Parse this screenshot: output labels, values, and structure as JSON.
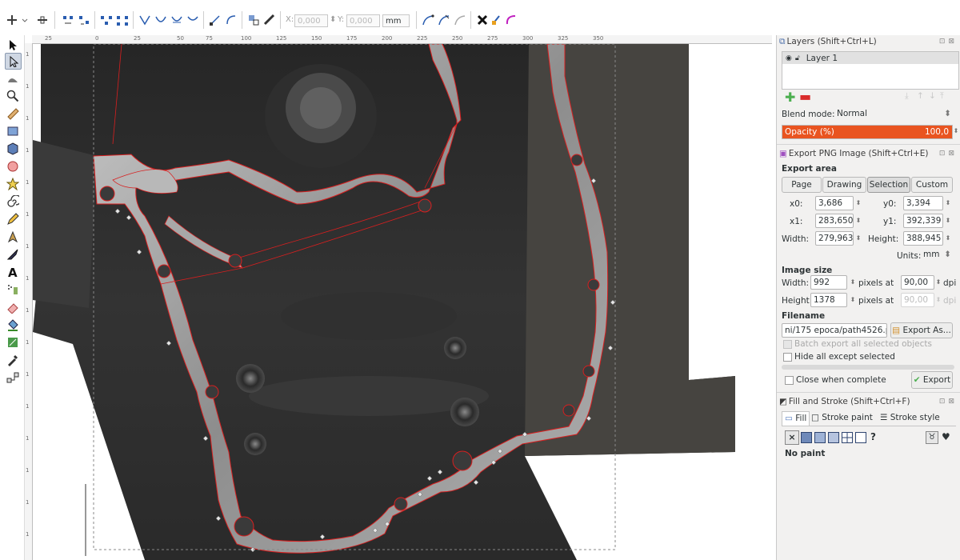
{
  "toolbar": {
    "x_label": "X:",
    "x_value": "0,000",
    "y_label": "Y:",
    "y_value": "0,000",
    "unit": "mm"
  },
  "rulers": {
    "top": [
      "25",
      "0",
      "25",
      "50",
      "75",
      "100",
      "125",
      "150",
      "175",
      "200",
      "225",
      "250",
      "275",
      "300",
      "325",
      "350"
    ],
    "left": [
      "1",
      "1",
      "1",
      "1",
      "1",
      "1",
      "1",
      "1",
      "1",
      "1",
      "1",
      "1",
      "1",
      "1",
      "1",
      "1"
    ]
  },
  "layers": {
    "title": "Layers (Shift+Ctrl+L)",
    "layer_name": "Layer 1",
    "blend_label": "Blend mode:",
    "blend_value": "Normal",
    "opacity_label": "Opacity (%)",
    "opacity_value": "100,0",
    "opacity_fraction": 1.0
  },
  "export": {
    "title": "Export PNG Image (Shift+Ctrl+E)",
    "area_label": "Export area",
    "tabs": [
      "Page",
      "Drawing",
      "Selection",
      "Custom"
    ],
    "active_tab": "Selection",
    "x0_label": "x0:",
    "x0": "3,686",
    "y0_label": "y0:",
    "y0": "3,394",
    "x1_label": "x1:",
    "x1": "283,650",
    "y1_label": "y1:",
    "y1": "392,339",
    "width_label": "Width:",
    "width": "279,963",
    "height_label": "Height:",
    "height": "388,945",
    "units_label": "Units:",
    "units": "mm",
    "image_size_label": "Image size",
    "img_width_label": "Width:",
    "img_width": "992",
    "img_height_label": "Height:",
    "img_height": "1378",
    "pixels_at": "pixels at",
    "dpi_value": "90,00",
    "dpi_value_disabled": "90,00",
    "dpi_label": "dpi",
    "filename_label": "Filename",
    "filename": "ni/175 epoca/path4526.png",
    "export_as": "Export As...",
    "batch_export": "Batch export all selected objects",
    "hide_all": "Hide all except selected",
    "close_when_complete": "Close when complete",
    "export_button": "Export"
  },
  "fill_stroke": {
    "title": "Fill and Stroke (Shift+Ctrl+F)",
    "tabs": [
      "Fill",
      "Stroke paint",
      "Stroke style"
    ],
    "active_tab": "Fill",
    "status": "No paint",
    "unknown_glyph": "?"
  },
  "colors": {
    "accent_orange": "#e95420",
    "selection_red": "#d81f1f"
  }
}
